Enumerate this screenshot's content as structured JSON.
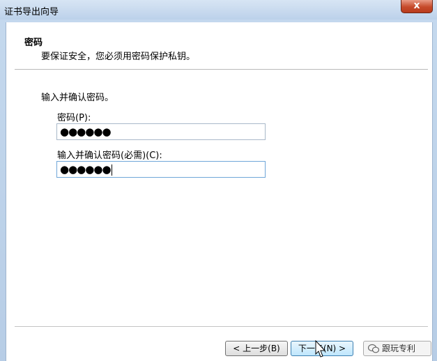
{
  "window": {
    "title": "证书导出向导",
    "close_label": "x"
  },
  "header": {
    "title": "密码",
    "subtitle": "要保证安全，您必须用密码保护私钥。"
  },
  "form": {
    "instruction": "输入并确认密码。",
    "password_label": "密码(P):",
    "password_value": "●●●●●●",
    "confirm_label": "输入并确认密码(必需)(C):",
    "confirm_value": "●●●●●●"
  },
  "buttons": {
    "back": "< 上一步(B)",
    "next": "下一步(N) >"
  },
  "watermark": {
    "text": "跟玩专利"
  }
}
